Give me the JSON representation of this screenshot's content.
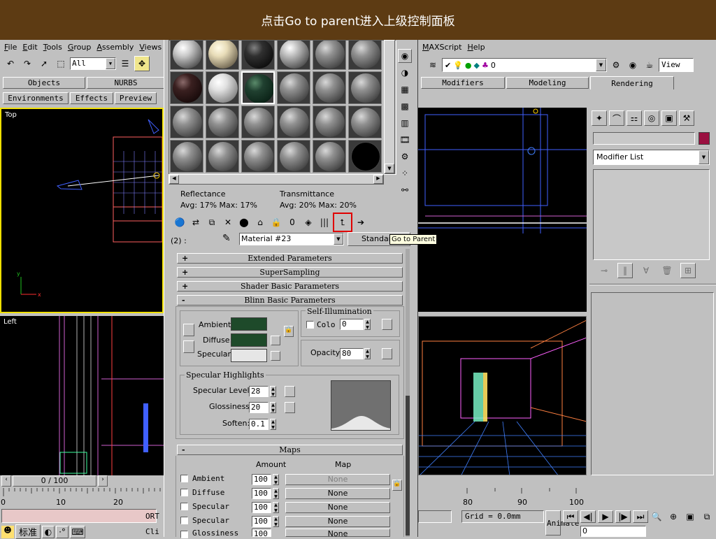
{
  "banner": {
    "title": "点击Go to parent进入上级控制面板"
  },
  "menubar": {
    "left": [
      "File",
      "Edit",
      "Tools",
      "Group",
      "Assembly",
      "Views"
    ],
    "right": [
      "MAXScript",
      "Help"
    ]
  },
  "toolbar": {
    "selection_filter": "All",
    "layer_value": "0",
    "view_label": "View"
  },
  "tab_panel": {
    "row1": [
      "Objects",
      "NURBS"
    ],
    "row2": [
      "Environments",
      "Effects",
      "Preview"
    ],
    "right": [
      "Modifiers",
      "Modeling",
      "Rendering"
    ]
  },
  "viewports": {
    "top": "Top",
    "left": "Left"
  },
  "command_panel": {
    "modifier_list": "Modifier List"
  },
  "timeline": {
    "frame": "0 / 100",
    "ticks_left": [
      "0",
      "10",
      "20"
    ],
    "ticks_right": [
      "80",
      "90",
      "100"
    ]
  },
  "status": {
    "grid": "Grid = 0.0mm",
    "animate": "Animate",
    "frame_field": "0",
    "ime": "标准",
    "ortho": "ORT",
    "cli": "Cli"
  },
  "material_editor": {
    "reflectance_label": "Reflectance",
    "reflectance_values": "Avg:  17% Max:  17%",
    "transmittance_label": "Transmittance",
    "transmittance_values": "Avg:  20% Max:  20%",
    "slot_label": "(2) :",
    "material_name": "Material #23",
    "type_button": "Standard",
    "tooltip": "Go to Parent",
    "rollouts": {
      "extended": "Extended Parameters",
      "supersampling": "SuperSampling",
      "shader_basic": "Shader Basic Parameters",
      "blinn_basic": "Blinn Basic Parameters",
      "maps": "Maps"
    },
    "blinn": {
      "ambient": "Ambient:",
      "diffuse": "Diffuse:",
      "specular": "Specular:",
      "self_illum_title": "Self-Illumination",
      "color_label": "Colo",
      "color_value": "0",
      "opacity_label": "Opacity:",
      "opacity_value": "80",
      "ambient_color": "#1e4a2a",
      "diffuse_color": "#1e4a2a",
      "specular_color": "#e6e6e6"
    },
    "specular_highlights": {
      "title": "Specular Highlights",
      "level_label": "Specular Level:",
      "level_value": "28",
      "gloss_label": "Glossiness:",
      "gloss_value": "20",
      "soften_label": "Soften:",
      "soften_value": "0.1"
    },
    "maps": {
      "amount_header": "Amount",
      "map_header": "Map",
      "rows": [
        {
          "name": "Ambient",
          "amount": "100",
          "map": "None"
        },
        {
          "name": "Diffuse",
          "amount": "100",
          "map": "None"
        },
        {
          "name": "Specular",
          "amount": "100",
          "map": "None"
        },
        {
          "name": "Specular",
          "amount": "100",
          "map": "None"
        },
        {
          "name": "Glossiness",
          "amount": "100",
          "map": "None"
        }
      ]
    }
  }
}
